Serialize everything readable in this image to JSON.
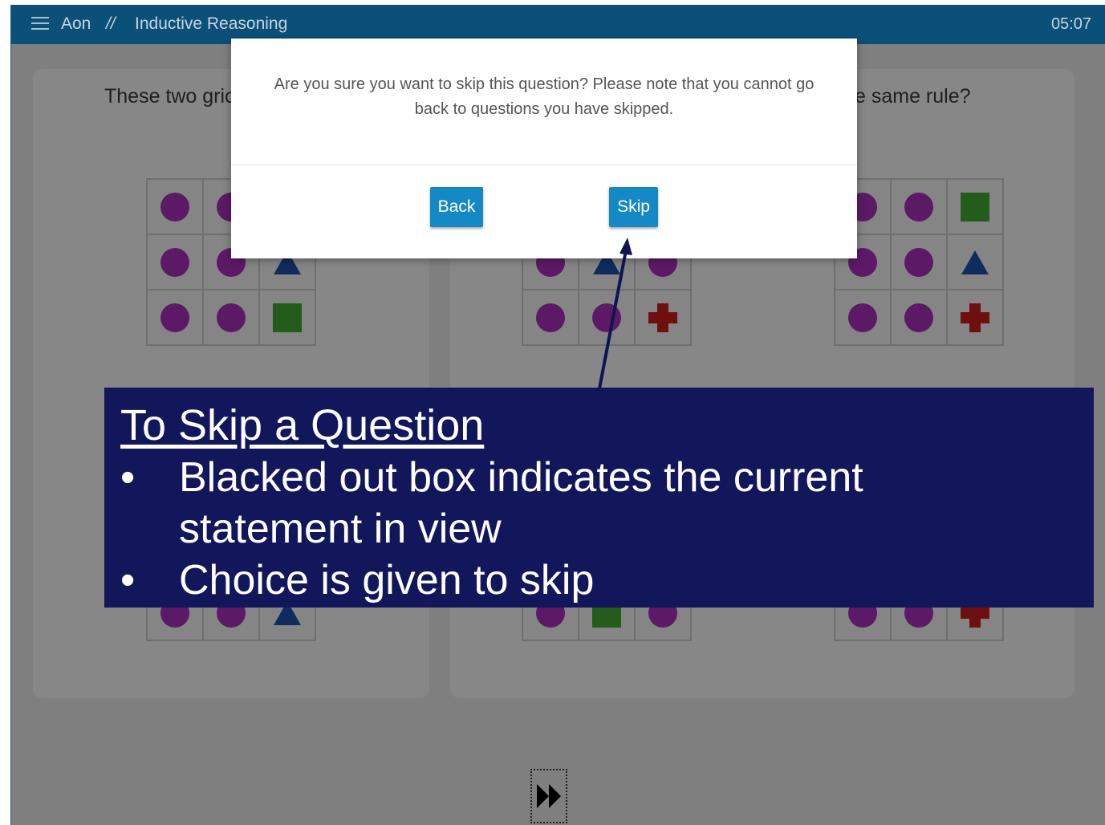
{
  "header": {
    "brand": "Aon",
    "separator": "//",
    "section": "Inductive Reasoning",
    "timer": "05:07"
  },
  "question": {
    "left_text": "These two gric",
    "right_text": "e same rule?"
  },
  "dialog": {
    "message": "Are you sure you want to skip this question? Please note that you cannot go back to questions you have skipped.",
    "back_label": "Back",
    "skip_label": "Skip"
  },
  "callout": {
    "title": "To Skip a Question",
    "bullet_symbol": "•",
    "bullets": [
      "Blacked out box indicates the current statement in view",
      "Choice is given to skip"
    ]
  },
  "colors": {
    "header": "#0b5079",
    "button": "#1588c6",
    "callout": "#11175a",
    "circle": "#5c1a66",
    "square": "#245c1c",
    "triangle": "#0f2c5c",
    "cross": "#6e1010"
  },
  "icons": {
    "menu": "hamburger-icon",
    "skip_nav": "fast-forward-icon"
  }
}
